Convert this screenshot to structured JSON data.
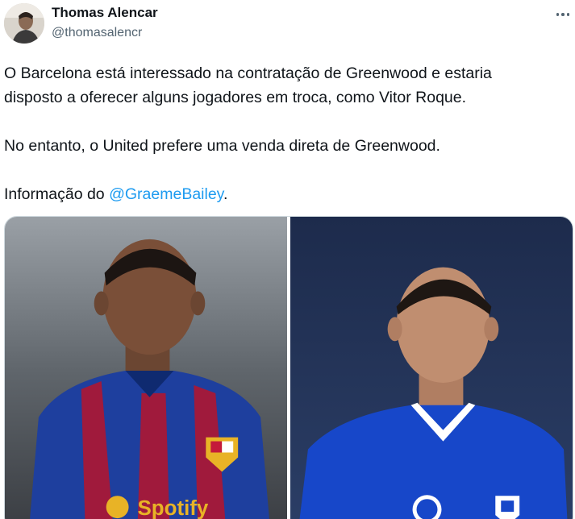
{
  "author": {
    "name": "Thomas Alencar",
    "handle": "@thomasalencr",
    "avatar_icon": "profile-photo"
  },
  "tweet": {
    "line1": "O Barcelona está interessado na contratação de Greenwood e estaria",
    "line2": "disposto a oferecer alguns jogadores em troca, como Vitor Roque.",
    "line3": "No entanto, o United prefere uma venda direta de Greenwood.",
    "line4_prefix": "Informação do ",
    "mention": "@GraemeBailey",
    "line4_suffix": "."
  },
  "media": {
    "left_photo": "photo-player-barcelona-kit",
    "right_photo": "photo-player-getafe-kit",
    "shirt_text": "Spotify"
  },
  "colors": {
    "link": "#1d9bf0",
    "secondary": "#536471",
    "barca_blue": "#1e3f9e",
    "barca_red": "#a01a3c",
    "getafe_blue": "#1747c9"
  }
}
